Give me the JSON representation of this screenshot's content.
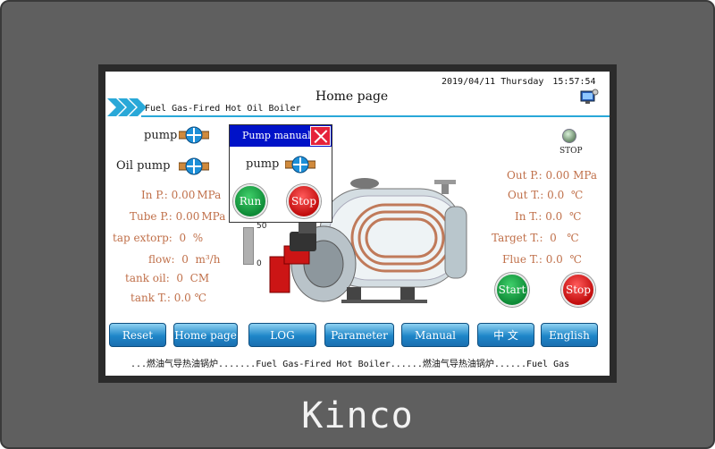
{
  "device": {
    "brand": "Kinco"
  },
  "header": {
    "subtitle": "Fuel Gas-Fired Hot Oil Boiler",
    "page_title": "Home page",
    "date": "2019/04/11 Thursday",
    "time": "15:57:54",
    "accent_color": "#29a8d8"
  },
  "left_panel": {
    "pump_label": "pump",
    "oil_pump_label": "Oil pump",
    "in_p": {
      "label": "In P.:",
      "value": "0.00",
      "unit": "MPa"
    },
    "tube_p": {
      "label": "Tube P.:",
      "value": "0.00",
      "unit": "MPa"
    },
    "tap_extorp": {
      "label": "tap extorp:",
      "value": "0",
      "unit": "%"
    },
    "flow": {
      "label": "flow:",
      "value": "0",
      "unit": "m³/h"
    },
    "tank_oil": {
      "label": "tank oil:",
      "value": "0",
      "unit": "CM"
    },
    "tank_t": {
      "label": "tank T.:",
      "value": "0.0",
      "unit": "℃"
    }
  },
  "gauge": {
    "max_label": "50",
    "min_label": "0"
  },
  "right_panel": {
    "status_text": "STOP",
    "out_p": {
      "label": "Out P.:",
      "value": "0.00",
      "unit": "MPa"
    },
    "out_t": {
      "label": "Out T.:",
      "value": "0.0",
      "unit": "℃"
    },
    "in_t": {
      "label": "In T.:",
      "value": "0.0",
      "unit": "℃"
    },
    "target_t": {
      "label": "Target T.:",
      "value": "0",
      "unit": "℃"
    },
    "flue_t": {
      "label": "Flue T.:",
      "value": "0.0",
      "unit": "℃"
    },
    "start_label": "Start",
    "stop_label": "Stop"
  },
  "popup": {
    "title": "Pump manual",
    "pump_label": "pump",
    "run_label": "Run",
    "stop_label": "Stop",
    "header_color": "#0012c8",
    "close_color": "#e5223a"
  },
  "nav": {
    "reset": "Reset",
    "home": "Home page",
    "log": "LOG",
    "parameter": "Parameter",
    "manual": "Manual",
    "chinese": "中 文",
    "english": "English"
  },
  "ticker": {
    "text": "...燃油气导热油锅炉.......Fuel Gas-Fired Hot Boiler......燃油气导热油锅炉......Fuel Gas"
  }
}
